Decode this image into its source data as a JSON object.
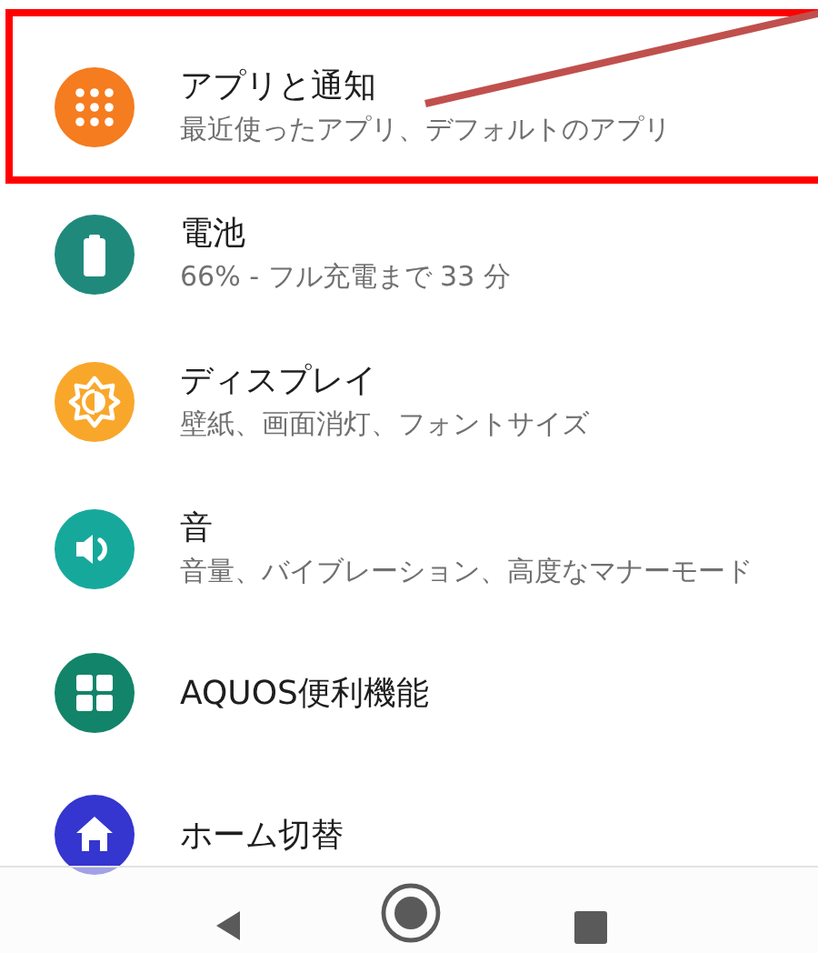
{
  "items": [
    {
      "kind": "apps",
      "title": "アプリと通知",
      "subtitle": "最近使ったアプリ、デフォルトのアプリ",
      "highlighted": true
    },
    {
      "kind": "battery",
      "title": "電池",
      "subtitle": "66% - フル充電まで 33 分",
      "highlighted": false
    },
    {
      "kind": "display",
      "title": "ディスプレイ",
      "subtitle": "壁紙、画面消灯、フォントサイズ",
      "highlighted": false
    },
    {
      "kind": "sound",
      "title": "音",
      "subtitle": "音量、バイブレーション、高度なマナーモード",
      "highlighted": false
    },
    {
      "kind": "grid",
      "title": "AQUOS便利機能",
      "highlighted": false
    },
    {
      "kind": "home",
      "title": "ホーム切替",
      "highlighted": false
    }
  ]
}
